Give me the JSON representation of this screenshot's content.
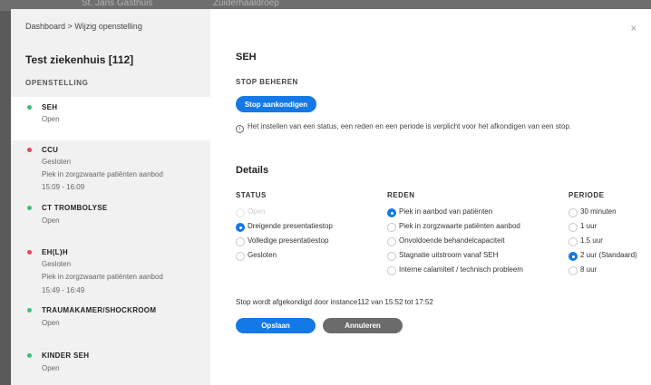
{
  "background": {
    "fragment_left": "St. Jans Gasthuis",
    "fragment_right": "Zuiderhaaldroep"
  },
  "modal": {
    "breadcrumb": "Dashboard > Wijzig openstelling",
    "close_label": "×",
    "hospital_name": "Test ziekenhuis [112]",
    "section_heading": "OPENSTELLING",
    "items": [
      {
        "name": "SEH",
        "lines": [
          "Open"
        ],
        "status": "green",
        "active": true
      },
      {
        "name": "CCU",
        "lines": [
          "Gesloten",
          "Piek in zorgzwaarte patiënten aanbod",
          "15:09 - 16:09"
        ],
        "status": "red",
        "active": false
      },
      {
        "name": "CT TROMBOLYSE",
        "lines": [
          "Open"
        ],
        "status": "green",
        "active": false
      },
      {
        "name": "EH(L)H",
        "lines": [
          "Gesloten",
          "Piek in zorgzwaarte patiënten aanbod",
          "15:49 - 16:49"
        ],
        "status": "red",
        "active": false
      },
      {
        "name": "TRAUMAKAMER/SHOCKROOM",
        "lines": [
          "Open"
        ],
        "status": "green",
        "active": false
      },
      {
        "name": "KINDER SEH",
        "lines": [
          "Open"
        ],
        "status": "green",
        "active": false
      }
    ]
  },
  "main": {
    "title": "SEH",
    "stop_heading": "STOP BEHEREN",
    "stop_button": "Stop aankondigen",
    "info_text": "Het instellen van een status, een reden en een periode is verplicht voor het afkondigen van een stop.",
    "details_title": "Details",
    "status": {
      "heading": "STATUS",
      "options": [
        {
          "label": "Open",
          "selected": false,
          "disabled": true
        },
        {
          "label": "Dreigende presentatiestop",
          "selected": true,
          "disabled": false
        },
        {
          "label": "Volledige presentatiestop",
          "selected": false,
          "disabled": false
        },
        {
          "label": "Gesloten",
          "selected": false,
          "disabled": false
        }
      ]
    },
    "reden": {
      "heading": "REDEN",
      "options": [
        {
          "label": "Piek in aanbod van patiënten",
          "selected": true
        },
        {
          "label": "Piek in zorgzwaarte patiënten aanbod",
          "selected": false
        },
        {
          "label": "Onvoldoende behandelcapaciteit",
          "selected": false
        },
        {
          "label": "Stagnatie uitstroom vanaf SEH",
          "selected": false
        },
        {
          "label": "Interne calamiteit / technisch probleem",
          "selected": false
        }
      ]
    },
    "periode": {
      "heading": "PERIODE",
      "options": [
        {
          "label": "30 minuten",
          "selected": false
        },
        {
          "label": "1 uur",
          "selected": false
        },
        {
          "label": "1.5 uur",
          "selected": false
        },
        {
          "label": "2 uur (Standaard)",
          "selected": true
        },
        {
          "label": "8 uur",
          "selected": false
        }
      ]
    },
    "footer_text": "Stop wordt afgekondigd door instance112 van 15:52 tot 17:52",
    "save_button": "Opslaan",
    "cancel_button": "Annuleren"
  },
  "colors": {
    "primary": "#1478e6",
    "status_open": "#3ac07a",
    "status_closed": "#e9455a",
    "cancel": "#6b6b6b"
  }
}
